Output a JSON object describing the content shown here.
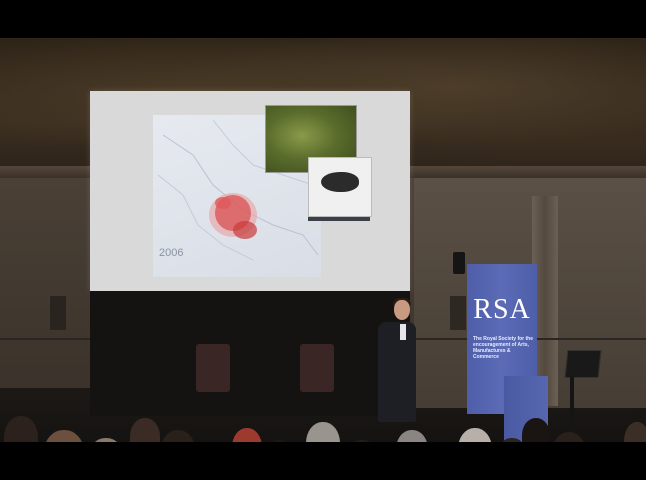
{
  "scene": {
    "description_free": true
  },
  "slide": {
    "year_label": "2006"
  },
  "banner": {
    "logo": "RSA",
    "subtext": "The Royal Society for the encouragement of Arts, Manufactures & Commerce"
  },
  "colors": {
    "banner_blue": "#5b6bb6",
    "screen_grey": "#d9d9d9",
    "map_red": "#d84a4a"
  }
}
